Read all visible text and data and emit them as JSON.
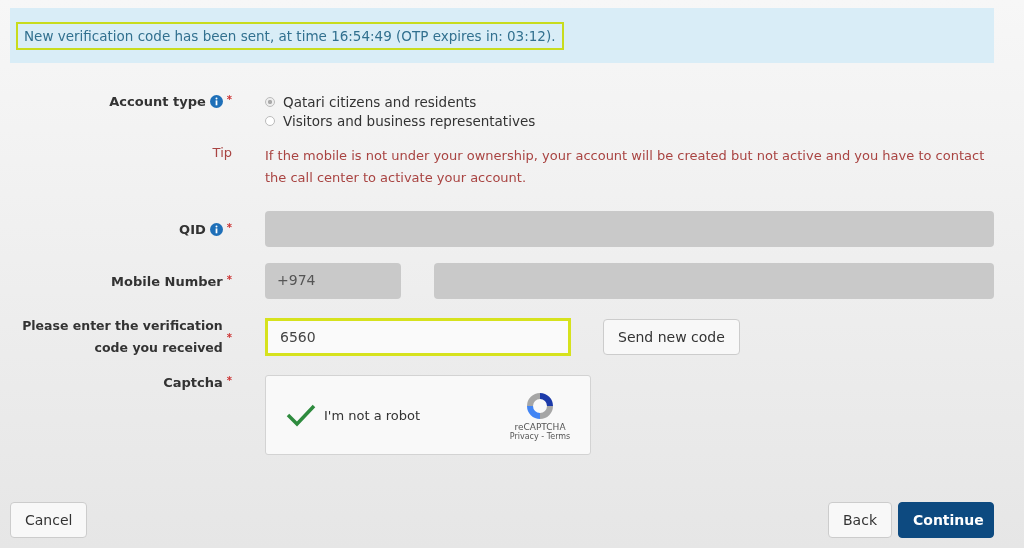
{
  "alert": {
    "text": "New verification code has been sent, at time 16:54:49 (OTP expires in: 03:12)."
  },
  "account_type": {
    "label": "Account type",
    "mark": "*",
    "options": [
      {
        "label": "Qatari citizens and residents",
        "selected": true
      },
      {
        "label": "Visitors and business representatives",
        "selected": false
      }
    ]
  },
  "tip": {
    "label": "Tip",
    "text": "If the mobile is not under your ownership, your account will be created but not active and you have to contact the call center to activate your account."
  },
  "qid": {
    "label": "QID",
    "mark": "*"
  },
  "mobile": {
    "label": "Mobile Number",
    "mark": "*",
    "prefix": "+974"
  },
  "verification": {
    "label": "Please enter the verification code you received",
    "mark": "*",
    "value": "6560",
    "button": "Send new code"
  },
  "captcha": {
    "label": "Captcha",
    "mark": "*",
    "checked": true,
    "text": "I'm not a robot",
    "brand": "reCAPTCHA",
    "links": "Privacy - Terms"
  },
  "buttons": {
    "cancel": "Cancel",
    "back": "Back",
    "continue": "Continue"
  }
}
